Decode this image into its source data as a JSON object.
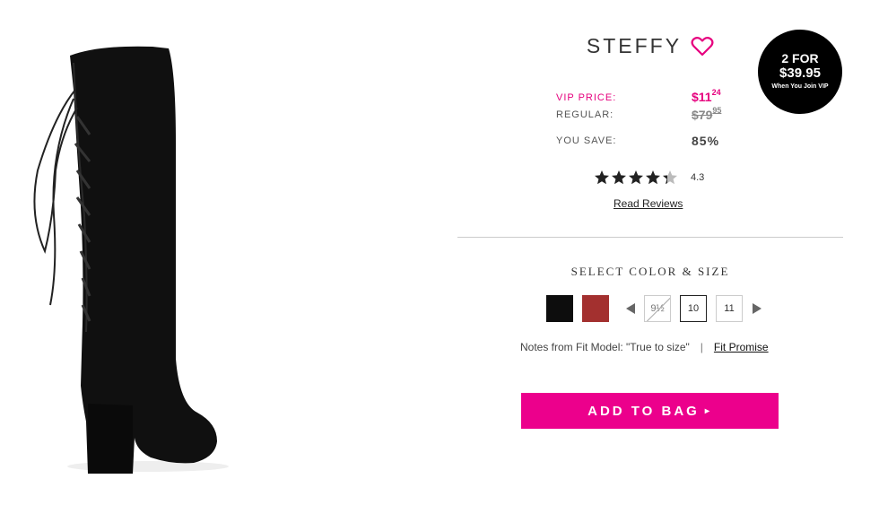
{
  "product": {
    "name": "STEFFY",
    "image_icon": "boot-image"
  },
  "promo": {
    "line1": "2 FOR",
    "line2": "$39.95",
    "line3": "When You Join VIP"
  },
  "pricing": {
    "vip_label": "VIP PRICE:",
    "vip_dollars": "$11",
    "vip_cents": "24",
    "regular_label": "REGULAR:",
    "regular_dollars": "$79",
    "regular_cents": "95",
    "save_label": "YOU SAVE:",
    "save_value": "85%"
  },
  "rating": {
    "value": "4.3",
    "stars_filled": 4.3,
    "stars_total": 5,
    "read_reviews": "Read Reviews"
  },
  "selection": {
    "heading": "SELECT COLOR & SIZE",
    "colors": [
      {
        "name": "black",
        "hex": "#0d0d0d"
      },
      {
        "name": "red",
        "hex": "#a3302f"
      }
    ],
    "sizes": [
      "9½",
      "10",
      "11"
    ],
    "selected_size": "10",
    "unavailable_size": "9½"
  },
  "fit": {
    "notes": "Notes from Fit Model: \"True to size\"",
    "separator": "|",
    "promise_link": "Fit Promise"
  },
  "cta": {
    "add_to_bag": "ADD TO BAG",
    "arrow": "▸"
  },
  "colors": {
    "brand_pink": "#ec008c",
    "vip_pink": "#e6007e"
  }
}
